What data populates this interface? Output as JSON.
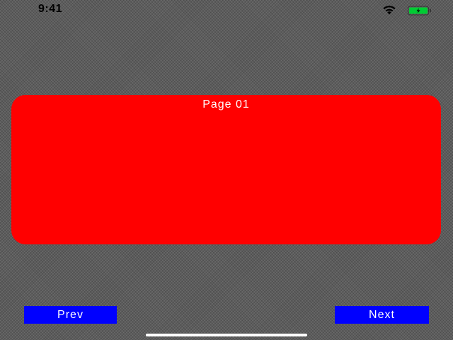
{
  "status_bar": {
    "time": "9:41",
    "icons": [
      "wifi-icon",
      "battery-icon"
    ],
    "battery_color": "#00cc33"
  },
  "page_card": {
    "title": "Page 01",
    "color": "#ff0000"
  },
  "buttons": {
    "prev_label": "Prev",
    "next_label": "Next",
    "color": "#0000ff"
  }
}
